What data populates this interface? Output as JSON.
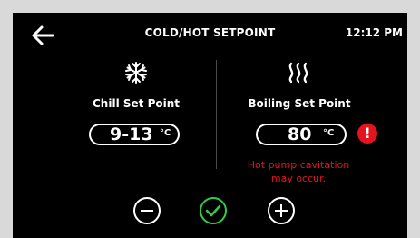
{
  "header": {
    "title": "COLD/HOT SETPOINT",
    "time": "12:12 PM"
  },
  "chill": {
    "label": "Chill Set Point",
    "value": "9-13",
    "unit": "°C",
    "icon": "snowflake-icon"
  },
  "boiling": {
    "label": "Boiling Set Point",
    "value": "80",
    "unit": "°C",
    "icon": "heat-waves-icon"
  },
  "warning": {
    "icon": "exclamation-icon",
    "symbol": "!",
    "line1": "Hot pump cavitation",
    "line2": "may occur."
  },
  "controls": {
    "decrease": "minus-icon",
    "confirm": "check-icon",
    "increase": "plus-icon"
  },
  "colors": {
    "background": "#000000",
    "text": "#ffffff",
    "warning": "#e3141e",
    "confirm": "#2ecc4a"
  }
}
